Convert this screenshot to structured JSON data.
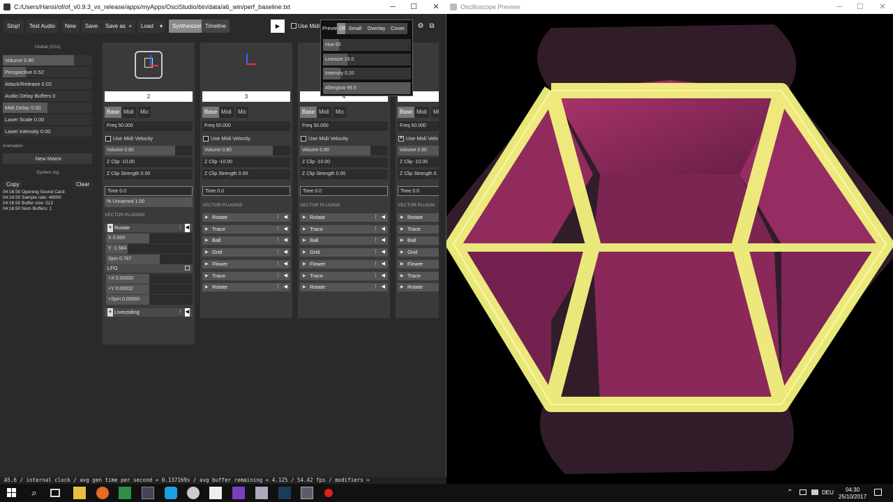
{
  "left_window": {
    "title": "C:/Users/Hansi/of/of_v0.9.3_vs_release/apps/myApps/OsciStudio/bin/data/a6_win/perf_baseline.txt",
    "window_buttons": {
      "minimize": "─",
      "maximize": "☐",
      "close": "✕"
    }
  },
  "toolbar": {
    "stop": "Stop!",
    "test_audio": "Test Audio",
    "new": "New",
    "save": "Save",
    "save_as": "Save as",
    "save_as_plus": "+",
    "load": "Load",
    "load_arrow": "▾",
    "synthesizer": "Synthesizer",
    "timeline": "Timeline",
    "play": "▶",
    "use_midi": "Use Midi",
    "settings": "⚙",
    "popout": "⧉"
  },
  "preview_popup": {
    "label": "Previe",
    "options": [
      "Off",
      "Small",
      "Overlay",
      "Cover"
    ],
    "selected": "Off",
    "sliders": [
      {
        "label": "Hue 65",
        "level": 0.18
      },
      {
        "label": "Linesize 16.0",
        "level": 0.28
      },
      {
        "label": "Intensity 0.20",
        "level": 0.2
      },
      {
        "label": "Afterglow 99.5",
        "level": 0.99
      }
    ]
  },
  "sidebar": {
    "header": "Global (Ch1)",
    "items": [
      {
        "label": "Volume 0.80",
        "level": 0.8
      },
      {
        "label": "Perspective 0.52",
        "level": 0.26
      },
      {
        "label": "Attack/Release 0.02",
        "level": 0.0
      },
      {
        "label": "Audio Delay Buffers 0",
        "level": 0.0
      },
      {
        "label": "Midi Delay 0.00",
        "level": 0.5
      },
      {
        "label": "Laser Scale 0.00",
        "level": 0.0
      },
      {
        "label": "Laser Intensity 0.00",
        "level": 0.0
      }
    ],
    "animation_header": "Animation",
    "new_matrix": "New Matrix",
    "system_log": "System log",
    "copy": "Copy",
    "clear": "Clear",
    "log": [
      "04:16:50 Opening Sound Card:",
      "04:16:50      Sample rate: 48000",
      "04:16:50      Buffer size: 512",
      "04:16:50      Num Buffers: 1"
    ]
  },
  "channels": [
    {
      "number": "2",
      "tabs": [
        "Base",
        "Midi",
        "Mic"
      ],
      "freq": "Freq 50.000",
      "use_midi_velocity": "Use Midi Velocity",
      "velocity_checked": false,
      "volume": {
        "label": "Volume 0.80",
        "level": 0.8
      },
      "zclip": "Z Clip -10.00",
      "zclip_strength": "Z Clip Strength 0.00",
      "time": "Time 0.0",
      "unnamed": "% Unnamed 1.00",
      "plugins_header": "VECTOR PLUGINS"
    },
    {
      "number": "3",
      "tabs": [
        "Base",
        "Midi",
        "Mic"
      ],
      "freq": "Freq 50.000",
      "use_midi_velocity": "Use Midi Velocity",
      "velocity_checked": false,
      "volume": {
        "label": "Volume 0.80",
        "level": 0.8
      },
      "zclip": "Z Clip -10.00",
      "zclip_strength": "Z Clip Strength 0.00",
      "time": "Time 0.0",
      "plugins_header": "VECTOR PLUGINS",
      "plugins": [
        "Rotate",
        "Trace",
        "Ball",
        "Grid",
        "Flower",
        "Trace",
        "Rotate"
      ]
    },
    {
      "number": "4",
      "tabs": [
        "Base",
        "Midi",
        "Mic"
      ],
      "freq": "Freq 50.000",
      "use_midi_velocity": "Use Midi Velocity",
      "velocity_checked": false,
      "volume": {
        "label": "Volume 0.80",
        "level": 0.8
      },
      "zclip": "Z Clip -10.00",
      "zclip_strength": "Z Clip Strength 0.00",
      "time": "Time 0.0",
      "plugins_header": "VECTOR PLUGINS",
      "plugins": [
        "Rotate",
        "Trace",
        "Ball",
        "Grid",
        "Flower",
        "Trace",
        "Rotate"
      ]
    },
    {
      "number": "5",
      "tabs": [
        "Base",
        "Midi",
        "Mi"
      ],
      "freq": "Freq 50.000",
      "use_midi_velocity": "Use Midi Velo",
      "velocity_checked": true,
      "volume": {
        "label": "Volume 0.80",
        "level": 0.8
      },
      "zclip": "Z Clip -10.00",
      "zclip_strength": "Z Clip Strength 0.",
      "time": "Time 0.0",
      "plugins_header": "VECTOR PLUGIN",
      "plugins": [
        "Rotate",
        "Trace",
        "Ball",
        "Grid",
        "Flower",
        "Trace",
        "Rotate"
      ]
    }
  ],
  "ch1_plugins": {
    "rotate": "Rotate",
    "rotate_params": [
      {
        "label": "X 0.000",
        "level": 0.5
      },
      {
        "label": "Y -1.584",
        "level": 0.25
      },
      {
        "label": "Spin 0.787",
        "level": 0.62
      }
    ],
    "lfo": "LFO",
    "lfo_params": [
      {
        "label": "+X 0.00000",
        "level": 0.5
      },
      {
        "label": "+Y 0.00002",
        "level": 0.5
      },
      {
        "label": "+Spin 0.00000",
        "level": 0.5
      }
    ],
    "livecoding": "Livecoding"
  },
  "status_line": "A5.6 / internal clock / avg gen time per second = 0.137169s  / avg buffer remaining = 4.125 / 54.42 fps / modifiers =",
  "right_window": {
    "title": "Oscilloscope Preview",
    "window_buttons": {
      "minimize": "─",
      "maximize": "☐",
      "close": "✕"
    }
  },
  "taskbar": {
    "lang": "DEU",
    "time": "04:30",
    "date": "25/10/2017",
    "tray_up": "⌃"
  },
  "colors": {
    "panel": "#2a2a2a",
    "accent_yellow": "#f4f488",
    "accent_magenta": "#b0306e"
  }
}
